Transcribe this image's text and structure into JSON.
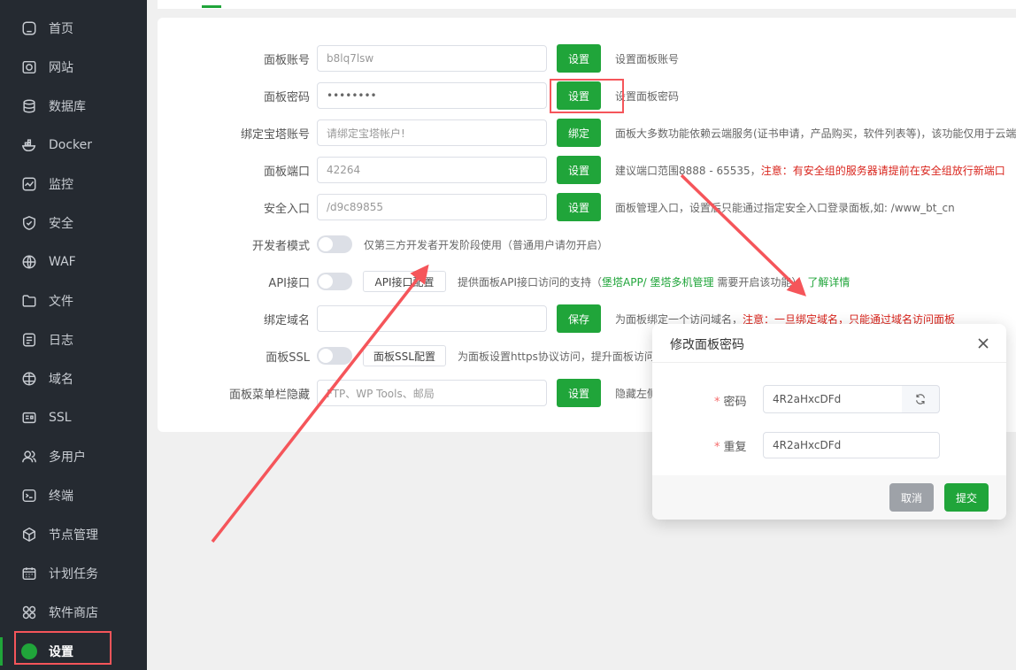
{
  "sidebar": {
    "items": [
      {
        "label": "首页",
        "icon": "home-icon"
      },
      {
        "label": "网站",
        "icon": "globe-window-icon"
      },
      {
        "label": "数据库",
        "icon": "database-icon"
      },
      {
        "label": "Docker",
        "icon": "docker-icon"
      },
      {
        "label": "监控",
        "icon": "monitor-icon"
      },
      {
        "label": "安全",
        "icon": "shield-icon"
      },
      {
        "label": "WAF",
        "icon": "waf-icon"
      },
      {
        "label": "文件",
        "icon": "folder-icon"
      },
      {
        "label": "日志",
        "icon": "log-icon"
      },
      {
        "label": "域名",
        "icon": "domain-icon"
      },
      {
        "label": "SSL",
        "icon": "ssl-icon"
      },
      {
        "label": "多用户",
        "icon": "user-icon"
      },
      {
        "label": "终端",
        "icon": "terminal-icon"
      },
      {
        "label": "节点管理",
        "icon": "node-icon"
      },
      {
        "label": "计划任务",
        "icon": "calendar-icon"
      },
      {
        "label": "软件商店",
        "icon": "apps-icon"
      },
      {
        "label": "设置",
        "icon": "settings-icon"
      }
    ],
    "active_index": 16
  },
  "settings": {
    "panel_account": {
      "label": "面板账号",
      "value": "b8lq7lsw",
      "button": "设置",
      "desc": "设置面板账号"
    },
    "panel_password": {
      "label": "面板密码",
      "value": "••••••••",
      "button": "设置",
      "desc": "设置面板密码"
    },
    "bind_account": {
      "label": "绑定宝塔账号",
      "placeholder": "请绑定宝塔帐户!",
      "button": "绑定",
      "desc": "面板大多数功能依赖云端服务(证书申请，产品购买，软件列表等)，该功能仅用于云端"
    },
    "panel_port": {
      "label": "面板端口",
      "value": "42264",
      "button": "设置",
      "desc": "建议端口范围8888 - 65535，",
      "desc_red": "注意：有安全组的服务器请提前在安全组放行新端口"
    },
    "security_entry": {
      "label": "安全入口",
      "value": "/d9c89855",
      "button": "设置",
      "desc": "面板管理入口，设置后只能通过指定安全入口登录面板,如: /www_bt_cn"
    },
    "developer_mode": {
      "label": "开发者模式",
      "desc": "仅第三方开发者开发阶段使用（普通用户请勿开启）"
    },
    "api": {
      "label": "API接口",
      "button": "API接口配置",
      "desc_a": "提供面板API接口访问的支持（",
      "desc_green": "堡塔APP/ 堡塔多机管理",
      "desc_b": " 需要开启该功能），",
      "desc_link": "了解详情"
    },
    "bind_domain": {
      "label": "绑定域名",
      "value": "",
      "button": "保存",
      "desc": "为面板绑定一个访问域名，",
      "desc_red": "注意：一旦绑定域名，只能通过域名访问面板"
    },
    "panel_ssl": {
      "label": "面板SSL",
      "button": "面板SSL配置",
      "desc": "为面板设置https协议访问，提升面板访问"
    },
    "menu_hide": {
      "label": "面板菜单栏隐藏",
      "placeholder": "FTP、WP Tools、邮局",
      "button": "设置",
      "desc": "隐藏左侧"
    }
  },
  "modal": {
    "title": "修改面板密码",
    "password_label": "密码",
    "password_value": "4R2aHxcDFd",
    "repeat_label": "重复",
    "repeat_value": "4R2aHxcDFd",
    "required_mark": "*",
    "cancel": "取消",
    "submit": "提交"
  },
  "colors": {
    "accent": "#20a53a",
    "warning": "#d9251d",
    "annotation": "#f5555a"
  }
}
